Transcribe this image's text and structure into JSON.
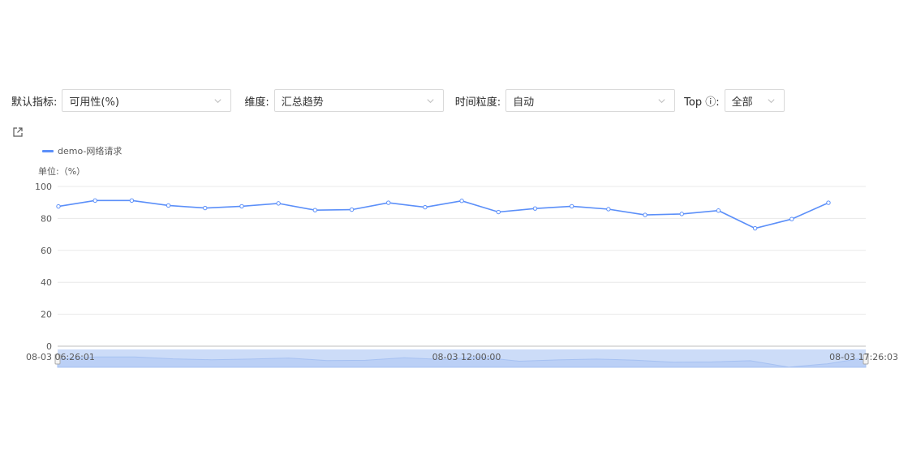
{
  "filters": {
    "metric_label": "默认指标:",
    "metric_value": "可用性(%)",
    "dimension_label": "维度:",
    "dimension_value": "汇总趋势",
    "granularity_label": "时间粒度:",
    "granularity_value": "自动",
    "top_label": "Top ⓘ:",
    "top_value": "全部"
  },
  "chart_data": {
    "type": "line",
    "unit_label": "单位:（%）",
    "ylim": [
      0,
      100
    ],
    "yticks": [
      0,
      20,
      40,
      60,
      80,
      100
    ],
    "grid": true,
    "legend_position": "top-left",
    "series": [
      {
        "name": "demo-网络请求",
        "color": "#5b8ff9",
        "values": [
          87.5,
          91.2,
          91.2,
          88.1,
          86.5,
          87.6,
          89.4,
          85.2,
          85.5,
          89.8,
          87.0,
          91.0,
          84.0,
          86.2,
          87.6,
          85.8,
          82.2,
          82.8,
          84.9,
          73.8,
          79.6,
          89.8
        ]
      }
    ],
    "x_start_label": "08-03 06:26:01",
    "x_mid_label": "08-03 12:00:00",
    "x_end_label": "08-03 17:26:03",
    "slider": {
      "start": 0,
      "end": 1
    }
  }
}
